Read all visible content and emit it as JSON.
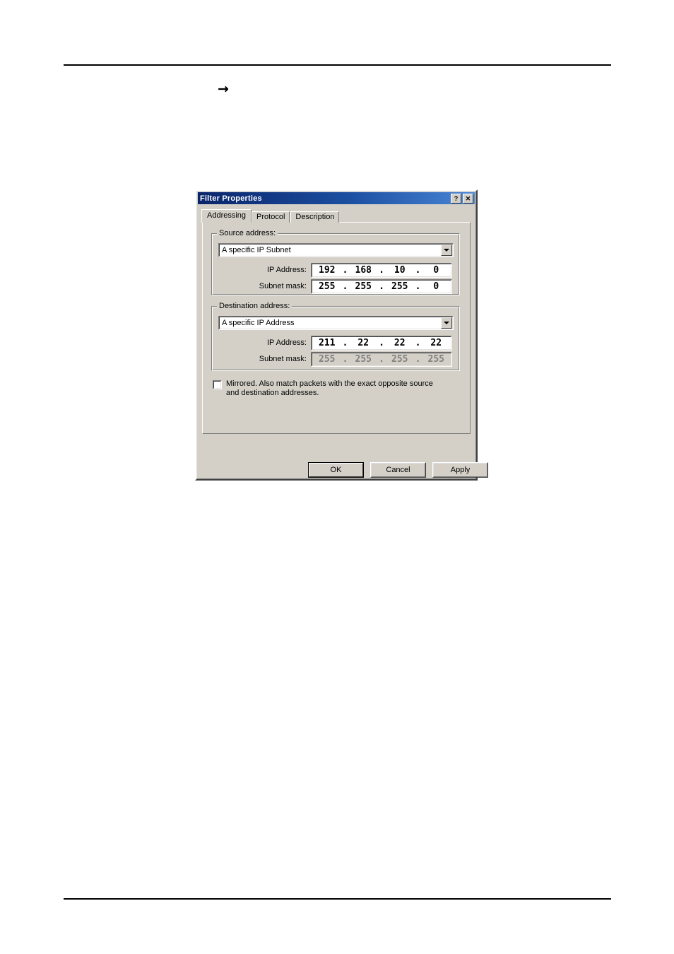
{
  "page": {
    "arrow_marker": "→",
    "background": "#ffffff"
  },
  "dialog": {
    "title": "Filter Properties",
    "titlebar_color": "#0a246a",
    "face_color": "#d4d0c8",
    "help_button": "?",
    "close_button": "✕",
    "tabs": [
      {
        "label": "Addressing",
        "active": true
      },
      {
        "label": "Protocol",
        "active": false
      },
      {
        "label": "Description",
        "active": false
      }
    ],
    "source": {
      "legend": "Source address:",
      "type_value": "A specific IP Subnet",
      "ip_label": "IP Address:",
      "ip_octets": [
        "192",
        "168",
        "10",
        "0"
      ],
      "mask_label": "Subnet mask:",
      "mask_octets": [
        "255",
        "255",
        "255",
        "0"
      ],
      "mask_disabled": false
    },
    "destination": {
      "legend": "Destination address:",
      "type_value": "A specific IP Address",
      "ip_label": "IP Address:",
      "ip_octets": [
        "211",
        "22",
        "22",
        "22"
      ],
      "mask_label": "Subnet mask:",
      "mask_octets": [
        "255",
        "255",
        "255",
        "255"
      ],
      "mask_disabled": true
    },
    "mirrored": {
      "checked": false,
      "label": "Mirrored. Also match packets with the exact opposite source and destination addresses."
    },
    "buttons": {
      "ok": "OK",
      "cancel": "Cancel",
      "apply": "Apply"
    },
    "separator": "."
  }
}
